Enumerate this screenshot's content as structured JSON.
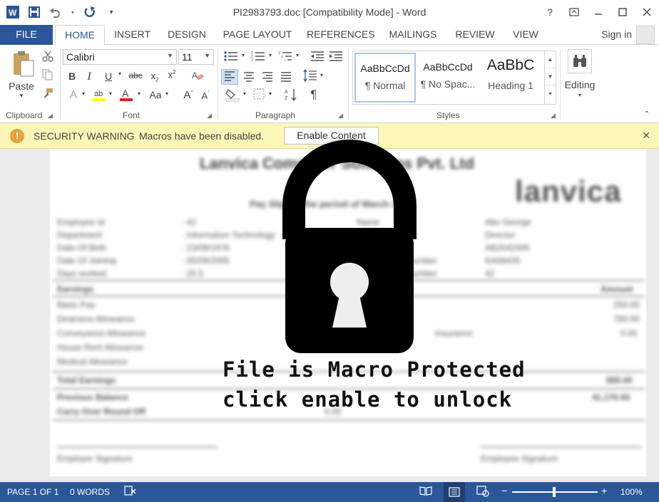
{
  "titlebar": {
    "title": "PI2983793.doc [Compatibility Mode] - Word",
    "help": "?",
    "qat_icons": [
      "word-app-icon",
      "save-icon",
      "undo-icon",
      "redo-icon",
      "customize-qat-icon"
    ]
  },
  "tabs": {
    "file": "FILE",
    "items": [
      "HOME",
      "INSERT",
      "DESIGN",
      "PAGE LAYOUT",
      "REFERENCES",
      "MAILINGS",
      "REVIEW",
      "VIEW"
    ],
    "signin": "Sign in"
  },
  "ribbon": {
    "clipboard": {
      "label": "Clipboard",
      "paste": "Paste"
    },
    "font": {
      "label": "Font",
      "family": "Calibri",
      "size": "11"
    },
    "paragraph": {
      "label": "Paragraph"
    },
    "styles": {
      "label": "Styles",
      "items": [
        {
          "preview": "AaBbCcDd",
          "name": "¶ Normal"
        },
        {
          "preview": "AaBbCcDd",
          "name": "¶ No Spac..."
        },
        {
          "preview": "AaBbC",
          "name": "Heading 1"
        }
      ]
    },
    "editing": {
      "label": "Editing"
    }
  },
  "security_bar": {
    "title": "SECURITY WARNING",
    "message": "Macros have been disabled.",
    "button": "Enable Content"
  },
  "overlay": {
    "line1": "File is Macro Protected",
    "line2": "click enable to unlock"
  },
  "status": {
    "page": "PAGE 1 OF 1",
    "words": "0 WORDS",
    "zoom": "100%",
    "zoom_level": 0.5
  },
  "colors": {
    "accent": "#2b579a",
    "warning_bar": "#fcf7b6",
    "warning_icon": "#e6a33e"
  }
}
